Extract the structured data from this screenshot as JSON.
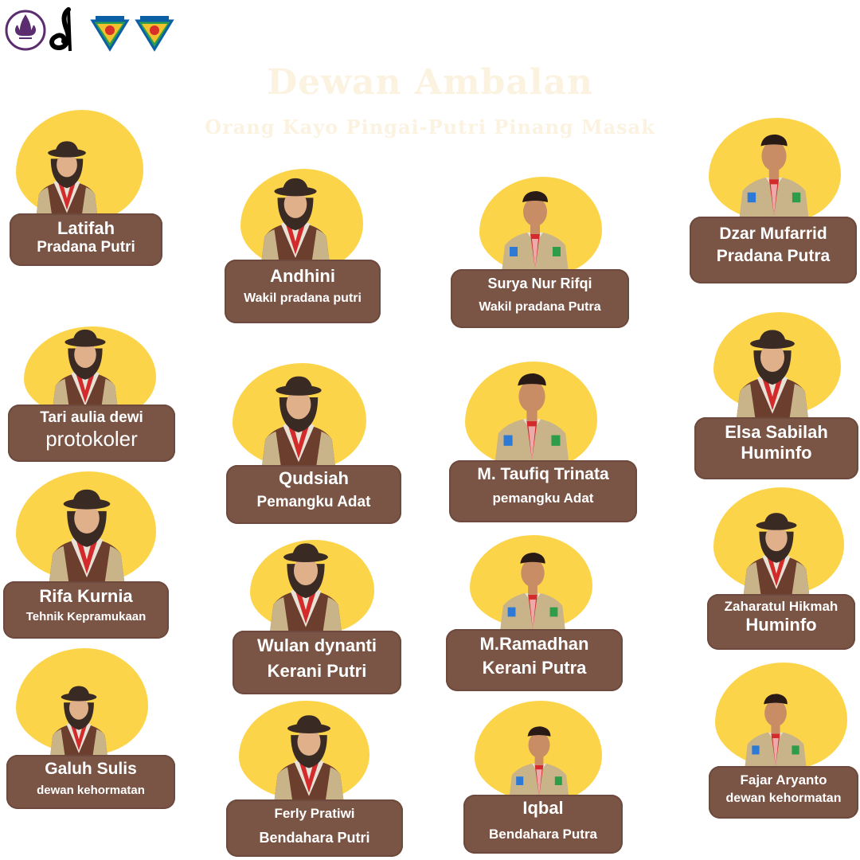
{
  "page": {
    "title": "Dewan Ambalan",
    "subtitle": "Orang Kayo Pingai-Putri Pinang Masak"
  },
  "logos": [
    "scout-lily-emblem",
    "tunas-kelapa-emblem",
    "regional-crest-emblem",
    "regional-crest-emblem"
  ],
  "colors": {
    "blob": "#fcd44a",
    "plate": "#7a5445",
    "title": "#fbf2e0"
  },
  "members": [
    {
      "name": "Latifah",
      "role": "Pradana Putri"
    },
    {
      "name": "Andhini",
      "role": "Wakil pradana putri"
    },
    {
      "name": "Surya Nur Rifqi",
      "role": "Wakil pradana Putra"
    },
    {
      "name": "Dzar Mufarrid",
      "role": "Pradana Putra"
    },
    {
      "name": "Tari aulia dewi",
      "role": "protokoler"
    },
    {
      "name": "Qudsiah",
      "role": "Pemangku Adat"
    },
    {
      "name": "M. Taufiq Trinata",
      "role": "pemangku Adat"
    },
    {
      "name": "Elsa Sabilah",
      "role": "Huminfo"
    },
    {
      "name": "Rifa Kurnia",
      "role": "Tehnik Kepramukaan"
    },
    {
      "name": "Wulan dynanti",
      "role": "Kerani Putri"
    },
    {
      "name": "M.Ramadhan",
      "role": "Kerani Putra"
    },
    {
      "name": "Zaharatul Hikmah",
      "role": "Huminfo"
    },
    {
      "name": "Galuh Sulis",
      "role": "dewan kehormatan"
    },
    {
      "name": "Ferly Pratiwi",
      "role": "Bendahara Putri"
    },
    {
      "name": "Iqbal",
      "role": "Bendahara Putra"
    },
    {
      "name": "Fajar Aryanto",
      "role": "dewan kehormatan"
    }
  ]
}
